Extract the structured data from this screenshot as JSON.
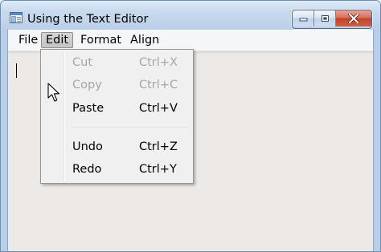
{
  "window": {
    "title": "Using the Text Editor",
    "controls": {
      "minimize": "minimize-icon",
      "maximize": "maximize-icon",
      "close": "close-icon"
    }
  },
  "menubar": {
    "items": [
      {
        "label": "File"
      },
      {
        "label": "Edit"
      },
      {
        "label": "Format"
      },
      {
        "label": "Align"
      }
    ],
    "active": "Edit"
  },
  "edit_menu": {
    "items": [
      {
        "label": "Cut",
        "shortcut": "Ctrl+X",
        "enabled": false
      },
      {
        "label": "Copy",
        "shortcut": "Ctrl+C",
        "enabled": false
      },
      {
        "label": "Paste",
        "shortcut": "Ctrl+V",
        "enabled": true
      },
      {
        "label": "Undo",
        "shortcut": "Ctrl+Z",
        "enabled": true
      },
      {
        "label": "Redo",
        "shortcut": "Ctrl+Y",
        "enabled": true
      }
    ]
  },
  "editor": {
    "text": ""
  },
  "colors": {
    "title_bar": "#c9daee",
    "close_button": "#c2432b",
    "client_background": "#ece9e7",
    "disabled_text": "#a6a6a6"
  }
}
